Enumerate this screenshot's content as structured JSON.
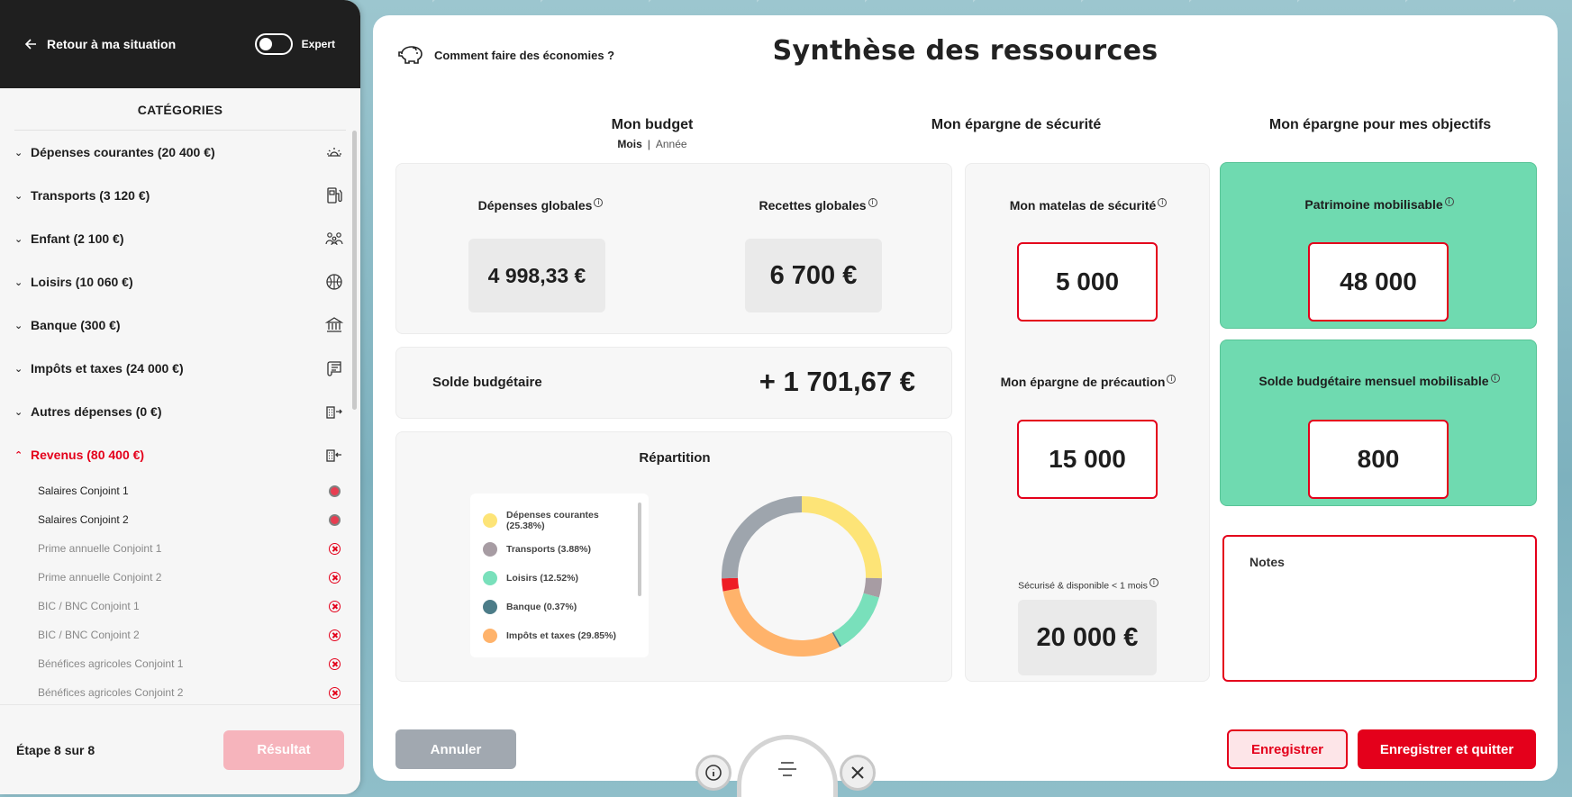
{
  "sidebar": {
    "back_label": "Retour à ma situation",
    "expert_label": "Expert",
    "categories_title": "CATÉGORIES",
    "categories": [
      {
        "label": "Dépenses courantes (20 400 €)",
        "icon": "sun-icon"
      },
      {
        "label": "Transports (3 120 €)",
        "icon": "fuel-pump-icon"
      },
      {
        "label": "Enfant (2 100 €)",
        "icon": "family-icon"
      },
      {
        "label": "Loisirs (10 060 €)",
        "icon": "basketball-icon"
      },
      {
        "label": "Banque (300 €)",
        "icon": "bank-icon"
      },
      {
        "label": "Impôts et taxes (24 000 €)",
        "icon": "scroll-icon"
      },
      {
        "label": "Autres dépenses (0 €)",
        "icon": "building-out-icon"
      },
      {
        "label": "Revenus (80 400 €)",
        "icon": "building-in-icon"
      }
    ],
    "income_items": [
      {
        "label": "Salaires Conjoint 1",
        "state": "on"
      },
      {
        "label": "Salaires Conjoint 2",
        "state": "on"
      },
      {
        "label": "Prime annuelle Conjoint 1",
        "state": "off"
      },
      {
        "label": "Prime annuelle Conjoint 2",
        "state": "off"
      },
      {
        "label": "BIC / BNC Conjoint 1",
        "state": "off"
      },
      {
        "label": "BIC / BNC Conjoint 2",
        "state": "off"
      },
      {
        "label": "Bénéfices agricoles Conjoint 1",
        "state": "off"
      },
      {
        "label": "Bénéfices agricoles Conjoint 2",
        "state": "off"
      }
    ],
    "step_label": "Étape 8 sur 8",
    "result_button": "Résultat"
  },
  "header": {
    "savings_tip": "Comment faire des économies ?",
    "title": "Synthèse des ressources"
  },
  "budget": {
    "heading": "Mon budget",
    "period_selected": "Mois",
    "period_alt": "Année",
    "expenses_label": "Dépenses globales",
    "expenses_value": "4 998,33 €",
    "income_label": "Recettes globales",
    "income_value": "6 700 €",
    "balance_label": "Solde budgétaire",
    "balance_value": "+ 1 701,67 €",
    "split_title": "Répartition"
  },
  "chart_data": {
    "type": "pie",
    "donut": true,
    "title": "Répartition",
    "slices": [
      {
        "label": "Dépenses courantes (25.38%)",
        "value": 25.38,
        "color": "#fde477"
      },
      {
        "label": "Transports (3.88%)",
        "value": 3.88,
        "color": "#a79ca3"
      },
      {
        "label": "Loisirs (12.52%)",
        "value": 12.52,
        "color": "#79e0bb"
      },
      {
        "label": "Banque (0.37%)",
        "value": 0.37,
        "color": "#4c7c88"
      },
      {
        "label": "Impôts et taxes (29.85%)",
        "value": 29.85,
        "color": "#ffb36b"
      },
      {
        "label": "",
        "value": 2.6,
        "color": "#ee1c25"
      },
      {
        "label": "",
        "value": 25.4,
        "color": "#9ea5ad"
      }
    ]
  },
  "safety": {
    "heading": "Mon épargne de sécurité",
    "mattress_label": "Mon matelas de sécurité",
    "mattress_value": "5 000",
    "precaution_label": "Mon épargne de précaution",
    "precaution_value": "15 000",
    "available_label": "Sécurisé & disponible < 1 mois",
    "available_value": "20 000 €"
  },
  "goals": {
    "heading": "Mon épargne pour mes objectifs",
    "assets_label": "Patrimoine mobilisable",
    "assets_value": "48 000",
    "monthly_label": "Solde budgétaire mensuel mobilisable",
    "monthly_value": "800",
    "notes_label": "Notes"
  },
  "actions": {
    "cancel": "Annuler",
    "save": "Enregistrer",
    "save_quit": "Enregistrer et quitter"
  },
  "colors": {
    "accent": "#e4001b",
    "green": "#6fdab0"
  }
}
